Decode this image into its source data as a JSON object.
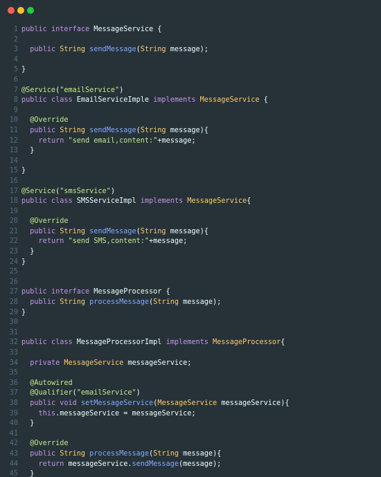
{
  "window": {
    "dots": [
      {
        "name": "close",
        "color": "#ff5f56"
      },
      {
        "name": "minimize",
        "color": "#ffbd2e"
      },
      {
        "name": "maximize",
        "color": "#27c93f"
      }
    ]
  },
  "colors": {
    "background": "#263238",
    "line_number": "#546e7a",
    "keyword": "#c792ea",
    "type": "#ffcb6b",
    "function": "#82aaff",
    "string": "#c3e88d",
    "annotation": "#c3e88d",
    "identifier": "#eeffff",
    "punctuation": "#89ddff"
  },
  "code": {
    "lines": [
      {
        "n": "1",
        "tokens": [
          [
            "kw",
            "public "
          ],
          [
            "kw",
            "interface "
          ],
          [
            "plain",
            "MessageService {"
          ]
        ]
      },
      {
        "n": "2",
        "tokens": []
      },
      {
        "n": "3",
        "tokens": [
          [
            "plain",
            "  "
          ],
          [
            "kw",
            "public "
          ],
          [
            "type",
            "String "
          ],
          [
            "fn",
            "sendMessage"
          ],
          [
            "plain",
            "("
          ],
          [
            "type",
            "String "
          ],
          [
            "ident",
            "message"
          ],
          [
            "plain",
            ");"
          ]
        ]
      },
      {
        "n": "4",
        "tokens": []
      },
      {
        "n": "5",
        "tokens": [
          [
            "plain",
            "}"
          ]
        ]
      },
      {
        "n": "6",
        "tokens": []
      },
      {
        "n": "7",
        "tokens": [
          [
            "ann",
            "@Service"
          ],
          [
            "plain",
            "("
          ],
          [
            "str",
            "\"emailService\""
          ],
          [
            "plain",
            ")"
          ]
        ]
      },
      {
        "n": "8",
        "tokens": [
          [
            "kw",
            "public "
          ],
          [
            "kw",
            "class "
          ],
          [
            "plain",
            "EmailServiceImple "
          ],
          [
            "kw",
            "implements "
          ],
          [
            "type",
            "MessageService "
          ],
          [
            "plain",
            "{"
          ]
        ]
      },
      {
        "n": "9",
        "tokens": []
      },
      {
        "n": "10",
        "tokens": [
          [
            "plain",
            "  "
          ],
          [
            "ann",
            "@Override"
          ]
        ]
      },
      {
        "n": "11",
        "tokens": [
          [
            "plain",
            "  "
          ],
          [
            "kw",
            "public "
          ],
          [
            "type",
            "String "
          ],
          [
            "fn",
            "sendMessage"
          ],
          [
            "plain",
            "("
          ],
          [
            "type",
            "String "
          ],
          [
            "ident",
            "message"
          ],
          [
            "plain",
            "){"
          ]
        ]
      },
      {
        "n": "12",
        "tokens": [
          [
            "plain",
            "    "
          ],
          [
            "kw",
            "return "
          ],
          [
            "str",
            "\"send email,content:\""
          ],
          [
            "plain",
            "+message;"
          ]
        ]
      },
      {
        "n": "13",
        "tokens": [
          [
            "plain",
            "  }"
          ]
        ]
      },
      {
        "n": "14",
        "tokens": []
      },
      {
        "n": "15",
        "tokens": [
          [
            "plain",
            "}"
          ]
        ]
      },
      {
        "n": "16",
        "tokens": []
      },
      {
        "n": "17",
        "tokens": [
          [
            "ann",
            "@Service"
          ],
          [
            "plain",
            "("
          ],
          [
            "str",
            "\"smsService\""
          ],
          [
            "plain",
            ")"
          ]
        ]
      },
      {
        "n": "18",
        "tokens": [
          [
            "kw",
            "public "
          ],
          [
            "kw",
            "class "
          ],
          [
            "plain",
            "SMSServiceImpl "
          ],
          [
            "kw",
            "implements "
          ],
          [
            "type",
            "MessageService"
          ],
          [
            "plain",
            "{"
          ]
        ]
      },
      {
        "n": "19",
        "tokens": []
      },
      {
        "n": "20",
        "tokens": [
          [
            "plain",
            "  "
          ],
          [
            "ann",
            "@Override"
          ]
        ]
      },
      {
        "n": "21",
        "tokens": [
          [
            "plain",
            "  "
          ],
          [
            "kw",
            "public "
          ],
          [
            "type",
            "String "
          ],
          [
            "fn",
            "sendMessage"
          ],
          [
            "plain",
            "("
          ],
          [
            "type",
            "String "
          ],
          [
            "ident",
            "message"
          ],
          [
            "plain",
            "){"
          ]
        ]
      },
      {
        "n": "22",
        "tokens": [
          [
            "plain",
            "    "
          ],
          [
            "kw",
            "return "
          ],
          [
            "str",
            "\"send SMS,content:\""
          ],
          [
            "plain",
            "+message;"
          ]
        ]
      },
      {
        "n": "23",
        "tokens": [
          [
            "plain",
            "  }"
          ]
        ]
      },
      {
        "n": "24",
        "tokens": [
          [
            "plain",
            "}"
          ]
        ]
      },
      {
        "n": "25",
        "tokens": []
      },
      {
        "n": "26",
        "tokens": []
      },
      {
        "n": "27",
        "tokens": [
          [
            "kw",
            "public "
          ],
          [
            "kw",
            "interface "
          ],
          [
            "plain",
            "MessageProcessor {"
          ]
        ]
      },
      {
        "n": "28",
        "tokens": [
          [
            "plain",
            "  "
          ],
          [
            "kw",
            "public "
          ],
          [
            "type",
            "String "
          ],
          [
            "fn",
            "processMessage"
          ],
          [
            "plain",
            "("
          ],
          [
            "type",
            "String "
          ],
          [
            "ident",
            "message"
          ],
          [
            "plain",
            ");"
          ]
        ]
      },
      {
        "n": "29",
        "tokens": [
          [
            "plain",
            "}"
          ]
        ]
      },
      {
        "n": "30",
        "tokens": []
      },
      {
        "n": "31",
        "tokens": []
      },
      {
        "n": "32",
        "tokens": [
          [
            "kw",
            "public "
          ],
          [
            "kw",
            "class "
          ],
          [
            "plain",
            "MessageProcessorImpl "
          ],
          [
            "kw",
            "implements "
          ],
          [
            "type",
            "MessageProcessor"
          ],
          [
            "plain",
            "{"
          ]
        ]
      },
      {
        "n": "33",
        "tokens": []
      },
      {
        "n": "34",
        "tokens": [
          [
            "plain",
            "  "
          ],
          [
            "kw",
            "private "
          ],
          [
            "type",
            "MessageService "
          ],
          [
            "ident",
            "messageService"
          ],
          [
            "plain",
            ";"
          ]
        ]
      },
      {
        "n": "35",
        "tokens": []
      },
      {
        "n": "36",
        "tokens": [
          [
            "plain",
            "  "
          ],
          [
            "ann",
            "@Autowired"
          ]
        ]
      },
      {
        "n": "37",
        "tokens": [
          [
            "plain",
            "  "
          ],
          [
            "ann",
            "@Qualifier"
          ],
          [
            "plain",
            "("
          ],
          [
            "str",
            "\"emailService\""
          ],
          [
            "plain",
            ")"
          ]
        ]
      },
      {
        "n": "38",
        "tokens": [
          [
            "plain",
            "  "
          ],
          [
            "kw",
            "public "
          ],
          [
            "kw",
            "void "
          ],
          [
            "fn",
            "setMessageService"
          ],
          [
            "plain",
            "("
          ],
          [
            "type",
            "MessageService "
          ],
          [
            "ident",
            "messageService"
          ],
          [
            "plain",
            "){"
          ]
        ]
      },
      {
        "n": "39",
        "tokens": [
          [
            "plain",
            "    "
          ],
          [
            "kw",
            "this"
          ],
          [
            "plain",
            "."
          ],
          [
            "ident",
            "messageService"
          ],
          [
            "plain",
            " = "
          ],
          [
            "ident",
            "messageService"
          ],
          [
            "plain",
            ";"
          ]
        ]
      },
      {
        "n": "40",
        "tokens": [
          [
            "plain",
            "  }"
          ]
        ]
      },
      {
        "n": "41",
        "tokens": []
      },
      {
        "n": "42",
        "tokens": [
          [
            "plain",
            "  "
          ],
          [
            "ann",
            "@Override"
          ]
        ]
      },
      {
        "n": "43",
        "tokens": [
          [
            "plain",
            "  "
          ],
          [
            "kw",
            "public "
          ],
          [
            "type",
            "String "
          ],
          [
            "fn",
            "processMessage"
          ],
          [
            "plain",
            "("
          ],
          [
            "type",
            "String "
          ],
          [
            "ident",
            "message"
          ],
          [
            "plain",
            "){"
          ]
        ]
      },
      {
        "n": "44",
        "tokens": [
          [
            "plain",
            "    "
          ],
          [
            "kw",
            "return "
          ],
          [
            "ident",
            "messageService"
          ],
          [
            "plain",
            "."
          ],
          [
            "fn",
            "sendMessage"
          ],
          [
            "plain",
            "("
          ],
          [
            "ident",
            "message"
          ],
          [
            "plain",
            ");"
          ]
        ]
      },
      {
        "n": "45",
        "tokens": [
          [
            "plain",
            "  }"
          ]
        ]
      }
    ]
  }
}
